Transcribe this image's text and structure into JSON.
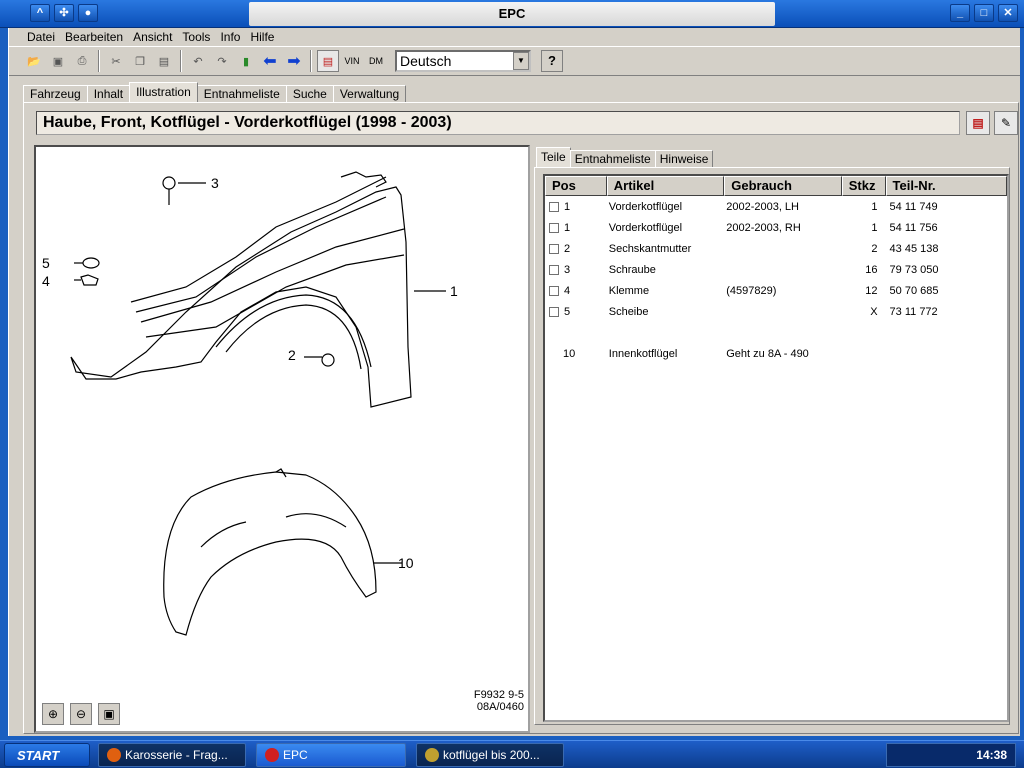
{
  "window": {
    "title": "EPC"
  },
  "menu": [
    "Datei",
    "Bearbeiten",
    "Ansicht",
    "Tools",
    "Info",
    "Hilfe"
  ],
  "toolbar": {
    "vin_label": "VIN",
    "language": "Deutsch",
    "help_label": "?"
  },
  "tabs": [
    "Fahrzeug",
    "Inhalt",
    "Illustration",
    "Entnahmeliste",
    "Suche",
    "Verwaltung"
  ],
  "selected_tab": "Illustration",
  "header": {
    "title": "Haube, Front, Kotflügel - Vorderkotflügel   (1998 - 2003)"
  },
  "illustration": {
    "callouts": [
      "3",
      "5",
      "4",
      "1",
      "2",
      "10"
    ],
    "code_line1": "F9932 9-5",
    "code_line2": "08A/0460"
  },
  "right_tabs": [
    "Teile",
    "Entnahmeliste",
    "Hinweise"
  ],
  "parts_table": {
    "columns": [
      "Pos",
      "Artikel",
      "Gebrauch",
      "Stkz",
      "Teil-Nr."
    ],
    "rows": [
      {
        "pos": "1",
        "artikel": "Vorderkotflügel",
        "gebrauch": "2002-2003, LH",
        "stkz": "1",
        "teilnr": "54 11 749",
        "checkbox": true
      },
      {
        "pos": "1",
        "artikel": "Vorderkotflügel",
        "gebrauch": "2002-2003, RH",
        "stkz": "1",
        "teilnr": "54 11 756",
        "checkbox": true
      },
      {
        "pos": "2",
        "artikel": "Sechskantmutter",
        "gebrauch": "",
        "stkz": "2",
        "teilnr": "43 45 138",
        "checkbox": true
      },
      {
        "pos": "3",
        "artikel": "Schraube",
        "gebrauch": "",
        "stkz": "16",
        "teilnr": "79 73 050",
        "checkbox": true
      },
      {
        "pos": "4",
        "artikel": "Klemme",
        "gebrauch": "(4597829)",
        "stkz": "12",
        "teilnr": "50 70 685",
        "checkbox": true
      },
      {
        "pos": "5",
        "artikel": "Scheibe",
        "gebrauch": "",
        "stkz": "X",
        "teilnr": "73 11 772",
        "checkbox": true
      },
      {
        "pos": "",
        "artikel": "",
        "gebrauch": "",
        "stkz": "",
        "teilnr": "",
        "checkbox": false
      },
      {
        "pos": "10",
        "artikel": "Innenkotflügel",
        "gebrauch": "Geht zu 8A - 490",
        "stkz": "",
        "teilnr": "",
        "checkbox": false
      }
    ]
  },
  "taskbar": {
    "start": "START",
    "tasks": [
      "Karosserie - Frag...",
      "EPC",
      "kotflügel bis 200..."
    ],
    "clock": "14:38"
  }
}
